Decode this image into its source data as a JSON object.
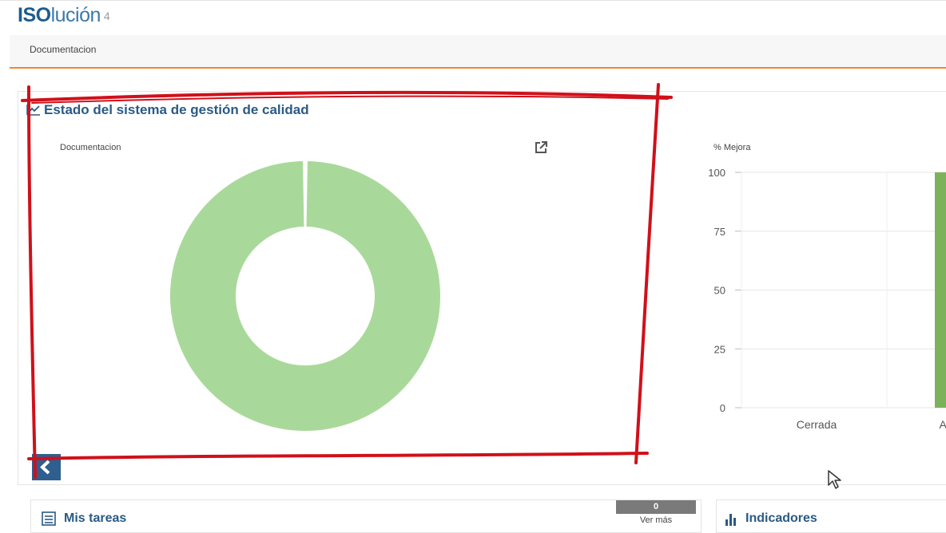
{
  "app": {
    "logo_iso": "ISO",
    "logo_lucion": "lución",
    "logo_version": "4"
  },
  "menu": {
    "items": [
      {
        "label": "Documentacion"
      }
    ]
  },
  "quality_panel": {
    "title": "Estado del sistema de gestión de calidad",
    "donut_label": "Documentacion",
    "bar_label": "% Mejora",
    "collapse_icon": "chevron-left-icon",
    "external_icon": "external-link-icon"
  },
  "tasks_panel": {
    "title": "Mis tareas",
    "count": "0",
    "more_label": "Ver más"
  },
  "indicators_panel": {
    "title": "Indicadores"
  },
  "colors": {
    "brand_blue": "#2a5a85",
    "accent_orange": "#f0862e",
    "donut_green": "#a9d99a",
    "bar_green": "#7cb25a",
    "annotation_red": "#d0101a"
  },
  "chart_data": [
    {
      "type": "pie",
      "subtype": "donut",
      "title": "Documentacion",
      "slices": [
        {
          "value": 100
        }
      ]
    },
    {
      "type": "bar",
      "ylabel": "% Mejora",
      "categories": [
        "Cerrada",
        "Ab"
      ],
      "values": [
        0,
        100
      ],
      "yticks": [
        0,
        25,
        50,
        75,
        100
      ],
      "ylim": [
        0,
        100
      ],
      "grid": true
    }
  ]
}
